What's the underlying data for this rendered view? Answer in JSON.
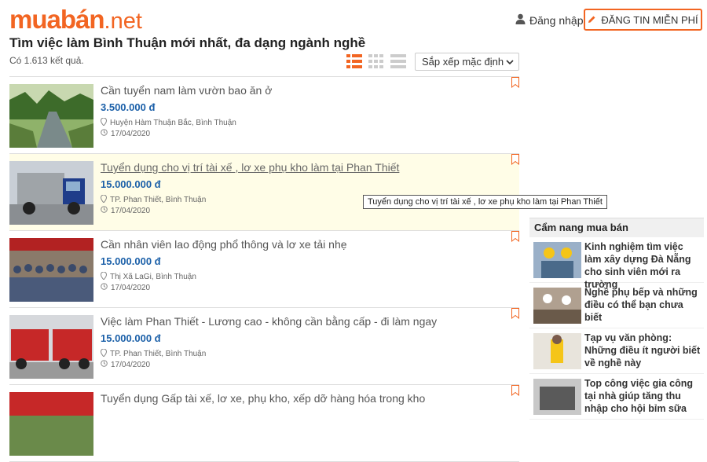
{
  "header": {
    "logo_main": "muabán",
    "logo_suffix": ".net",
    "login_label": "Đăng nhập",
    "post_button_label": "ĐĂNG TIN MIỄN PHÍ"
  },
  "page": {
    "title": "Tìm việc làm Bình Thuận mới nhất, đa dạng ngành nghề",
    "result_count": "Có 1.613 kết quả.",
    "sort_selected": "Sắp xếp mặc định",
    "view_modes": [
      "list-view-icon",
      "grid-view-icon",
      "compact-view-icon"
    ],
    "active_view": "list-view-icon"
  },
  "listings": [
    {
      "title": "Cần tuyển nam làm vườn bao ăn ở",
      "price": "3.500.000 đ",
      "location": "Huyện Hàm Thuận Bắc, Bình Thuận",
      "date": "17/04/2020"
    },
    {
      "title": "Tuyển dụng cho vị trí tài xế , lơ xe phụ kho làm tại Phan Thiết",
      "price": "15.000.000 đ",
      "location": "TP. Phan Thiết, Bình Thuận",
      "date": "17/04/2020"
    },
    {
      "title": "Cần nhân viên lao động phổ thông và lơ xe tải nhẹ",
      "price": "15.000.000 đ",
      "location": "Thị Xã LaGi, Bình Thuận",
      "date": "17/04/2020"
    },
    {
      "title": "Việc làm Phan Thiết - Lương cao - không cần bằng cấp - đi làm ngay",
      "price": "15.000.000 đ",
      "location": "TP. Phan Thiết, Bình Thuận",
      "date": "17/04/2020"
    },
    {
      "title": "Tuyển dụng Gấp tài xế, lơ xe, phụ kho, xếp dỡ hàng hóa trong kho",
      "price": "",
      "location": "",
      "date": ""
    }
  ],
  "tooltip": "Tuyển dụng cho vị trí tài xế , lơ xe phụ kho làm tại Phan Thiết",
  "guide": {
    "heading": "Cẩm nang mua bán",
    "items": [
      {
        "title": "Kinh nghiệm tìm việc làm xây dựng Đà Nẵng cho sinh viên mới ra trường"
      },
      {
        "title": "Nghề phụ bếp và những điều có thể bạn chưa biết"
      },
      {
        "title": "Tạp vụ văn phòng: Những điều ít người biết về nghề này"
      },
      {
        "title": "Top công việc gia công tại nhà giúp tăng thu nhập cho hội bỉm sữa"
      }
    ]
  },
  "colors": {
    "brand": "#f26522",
    "price": "#1a5fa8",
    "highlight_bg": "#fffde7"
  }
}
